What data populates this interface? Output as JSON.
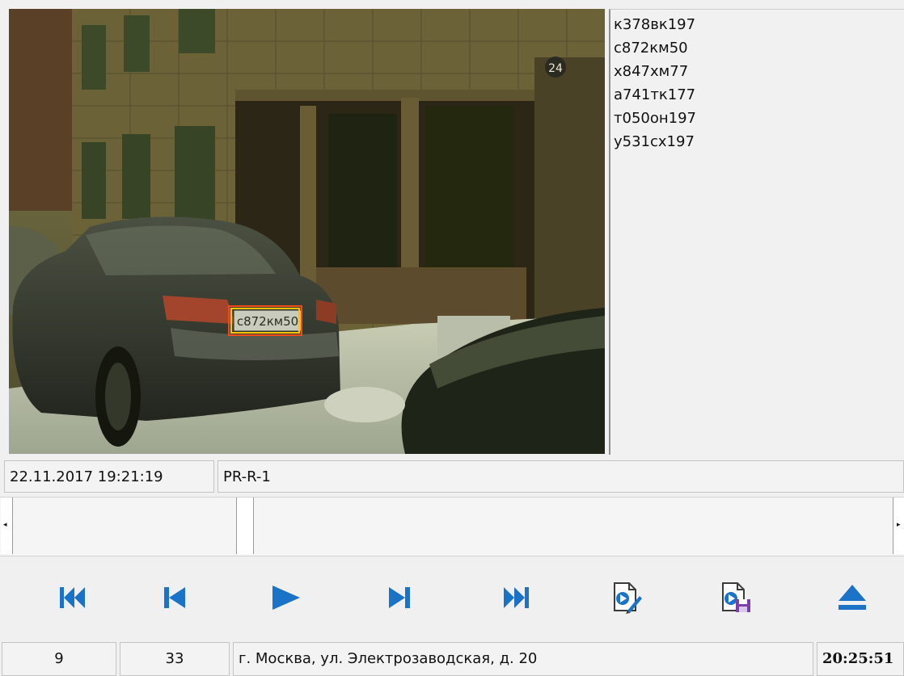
{
  "recognized_plates": [
    "к378вк197",
    "с872км50",
    "х847хм77",
    "а741тк177",
    "т050он197",
    "у531сх197"
  ],
  "camera_view": {
    "plate_text": "с872км50",
    "building_number": "24",
    "highlight_color": "#f7a400"
  },
  "info_bar": {
    "timestamp": "22.11.2017 19:21:19",
    "camera_name": "PR-R-1"
  },
  "scrollbar": {
    "left_arrow": "◂",
    "right_arrow": "▸",
    "position": 0.27
  },
  "toolbar": {
    "accent_color": "#1a73c7",
    "buttons": [
      {
        "name": "first-frame-button",
        "icon": "skip-to-start-icon"
      },
      {
        "name": "previous-frame-button",
        "icon": "step-back-icon"
      },
      {
        "name": "play-button",
        "icon": "play-icon"
      },
      {
        "name": "next-frame-button",
        "icon": "step-forward-icon"
      },
      {
        "name": "last-frame-button",
        "icon": "skip-to-end-icon"
      },
      {
        "name": "edit-record-button",
        "icon": "edit-document-icon"
      },
      {
        "name": "save-record-button",
        "icon": "save-document-icon"
      },
      {
        "name": "eject-button",
        "icon": "eject-icon"
      }
    ]
  },
  "status_bar": {
    "count_a": "9",
    "count_b": "33",
    "address": "г. Москва, ул. Электрозаводская, д. 20",
    "time": "20:25:51"
  }
}
